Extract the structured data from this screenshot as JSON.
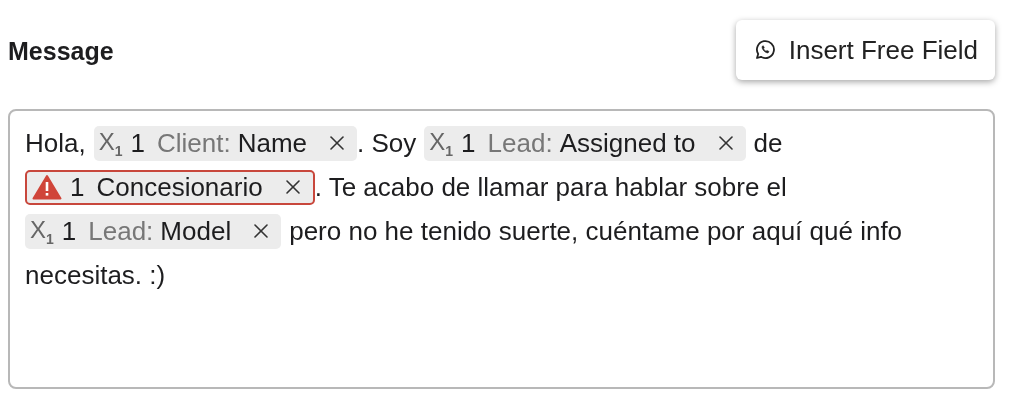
{
  "heading": "Message",
  "insert_button": {
    "label": "Insert Free Field"
  },
  "message_lines": [
    [
      {
        "kind": "text",
        "text": "Hola,"
      },
      {
        "kind": "variable",
        "symbol": "X$_{1}$",
        "count": "1",
        "prefix": "Client:",
        "label": "Name"
      },
      {
        "kind": "text",
        "text": ". Soy"
      },
      {
        "kind": "variable",
        "symbol": "X$_{1}$",
        "count": "1",
        "prefix": "Lead:",
        "label": "Assigned to"
      },
      {
        "kind": "text",
        "text": "de"
      }
    ],
    [
      {
        "kind": "warning",
        "count": "1",
        "label": "Concesionario"
      },
      {
        "kind": "text",
        "text": ". Te acabo de llamar para hablar sobre el"
      }
    ],
    [
      {
        "kind": "variable",
        "symbol": "X$_{1}$",
        "count": "1",
        "prefix": "Lead:",
        "label": "Model"
      },
      {
        "kind": "text",
        "text": "pero no he tenido suerte, cuéntame por aquí qué info"
      }
    ],
    [
      {
        "kind": "text",
        "text": "necesitas. :)"
      }
    ]
  ]
}
